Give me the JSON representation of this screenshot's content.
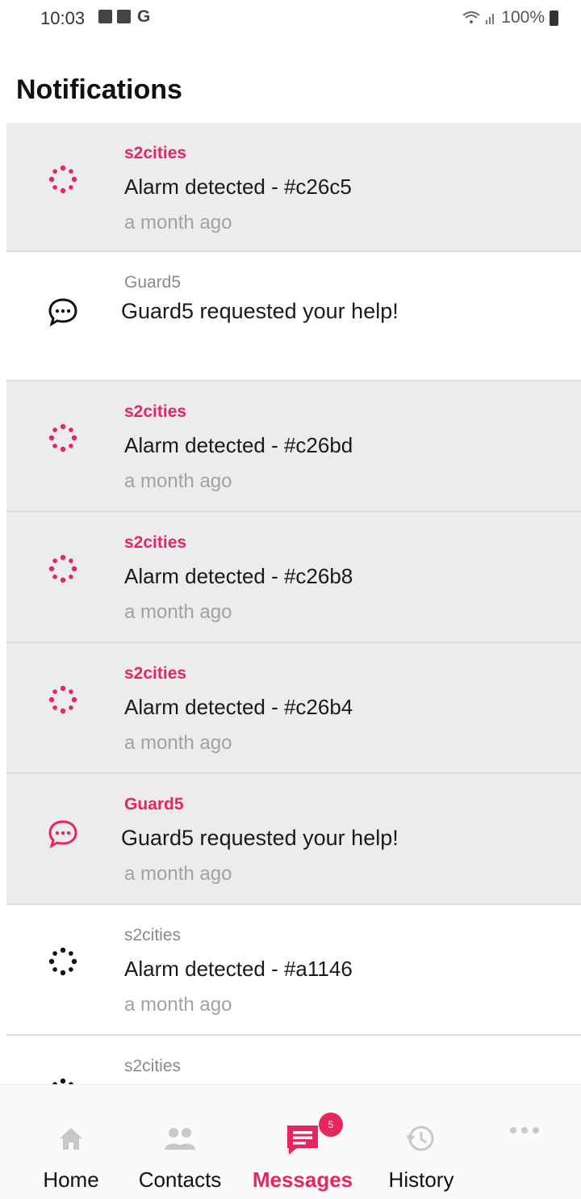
{
  "status_bar": {
    "time": "10:03",
    "carrier_icon": "G",
    "battery": "100%"
  },
  "page": {
    "title": "Notifications"
  },
  "notifications": [
    {
      "sender": "s2cities",
      "message": "Alarm detected - #c26c5",
      "time": "a month ago",
      "unread": true,
      "icon": "alarm-icon"
    },
    {
      "sender": "Guard5",
      "message": "Guard5 requested your help!",
      "time": "",
      "unread": false,
      "icon": "chat-icon"
    },
    {
      "sender": "s2cities",
      "message": "Alarm detected - #c26bd",
      "time": "a month ago",
      "unread": true,
      "icon": "alarm-icon"
    },
    {
      "sender": "s2cities",
      "message": "Alarm detected - #c26b8",
      "time": "a month ago",
      "unread": true,
      "icon": "alarm-icon"
    },
    {
      "sender": "s2cities",
      "message": "Alarm detected - #c26b4",
      "time": "a month ago",
      "unread": true,
      "icon": "alarm-icon"
    },
    {
      "sender": "Guard5",
      "message": "Guard5 requested your help!",
      "time": "a month ago",
      "unread": true,
      "icon": "chat-icon"
    },
    {
      "sender": "s2cities",
      "message": "Alarm detected - #a1146",
      "time": "a month ago",
      "unread": false,
      "icon": "alarm-icon"
    },
    {
      "sender": "s2cities",
      "message": "",
      "time": "",
      "unread": false,
      "icon": "alarm-icon"
    }
  ],
  "bottom_nav": {
    "items": [
      {
        "label": "Home",
        "icon": "home-icon",
        "active": false
      },
      {
        "label": "Contacts",
        "icon": "contacts-icon",
        "active": false
      },
      {
        "label": "Messages",
        "icon": "messages-icon",
        "active": true,
        "badge": "5"
      },
      {
        "label": "History",
        "icon": "history-icon",
        "active": false
      },
      {
        "label": "",
        "icon": "more-icon",
        "active": false
      }
    ]
  },
  "colors": {
    "accent": "#e8265e",
    "unread_bg": "#ececec",
    "divider": "#dcdcdc"
  }
}
